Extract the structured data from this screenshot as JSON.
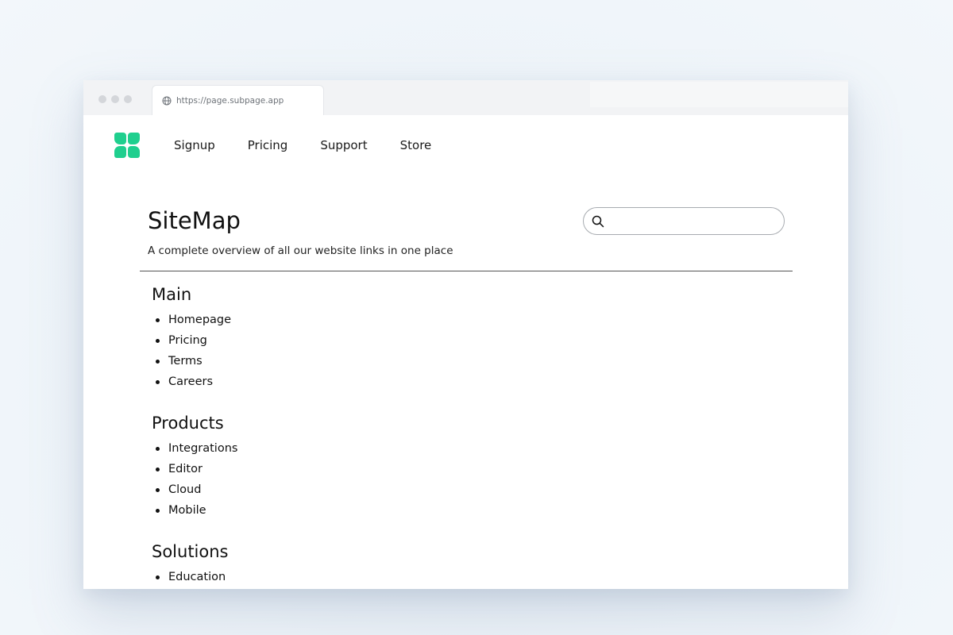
{
  "browser": {
    "url": "https://page.subpage.app"
  },
  "nav": {
    "items": [
      "Signup",
      "Pricing",
      "Support",
      "Store"
    ]
  },
  "brand": {
    "accent": "#1fcf8e"
  },
  "page": {
    "title": "SiteMap",
    "subtitle": "A complete overview of all our website links in one place"
  },
  "search": {
    "value": "",
    "placeholder": ""
  },
  "sections": [
    {
      "title": "Main",
      "links": [
        "Homepage",
        "Pricing",
        "Terms",
        "Careers"
      ]
    },
    {
      "title": "Products",
      "links": [
        "Integrations",
        "Editor",
        "Cloud",
        "Mobile"
      ]
    },
    {
      "title": "Solutions",
      "links": [
        "Education"
      ]
    }
  ]
}
